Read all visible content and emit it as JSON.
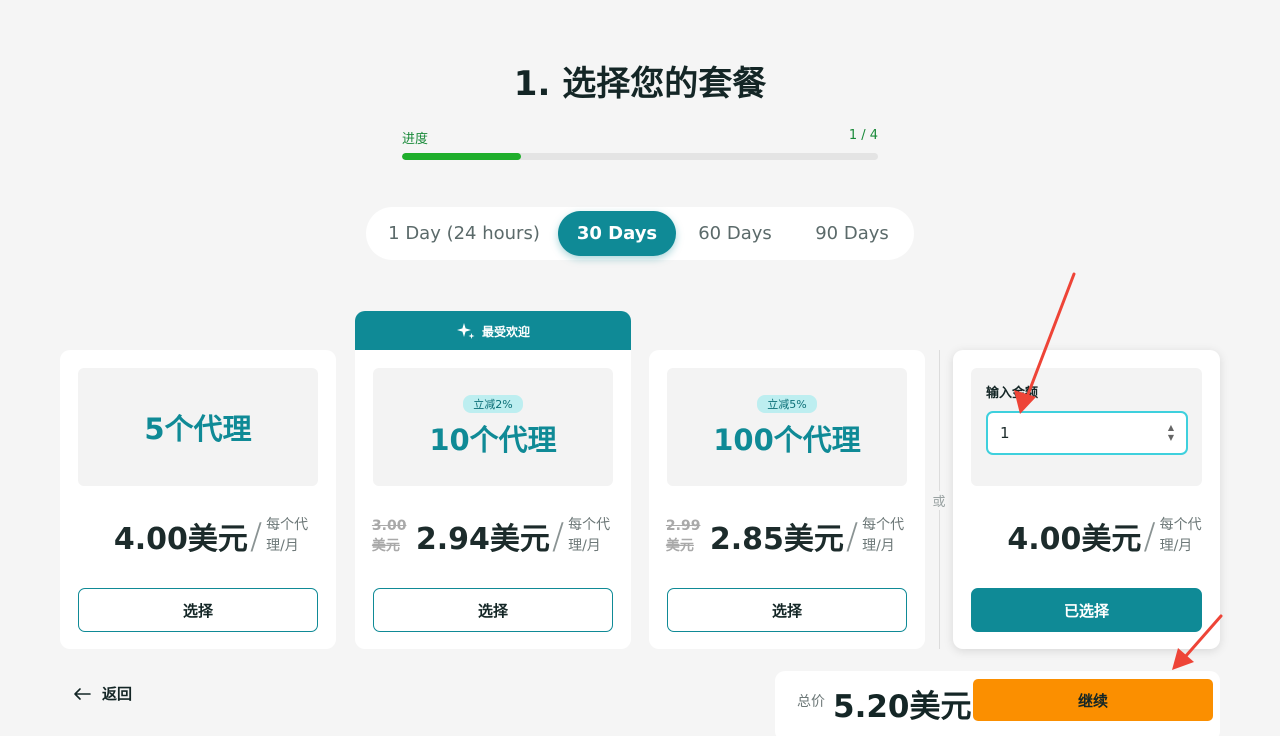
{
  "page_title": "1. 选择您的套餐",
  "progress": {
    "label": "进度",
    "step_text": "1 / 4",
    "fraction": 0.25
  },
  "duration_tabs": [
    {
      "label": "1 Day (24 hours)",
      "active": false
    },
    {
      "label": "30 Days",
      "active": true
    },
    {
      "label": "60 Days",
      "active": false
    },
    {
      "label": "90 Days",
      "active": false
    }
  ],
  "popular_banner": {
    "label": "最受欢迎",
    "icon": "sparkle-icon"
  },
  "plans": [
    {
      "name": "5个代理",
      "badge": "",
      "old_price": "",
      "price": "4.00美元",
      "slash": "/",
      "per": "每个代理/月",
      "button": "选择"
    },
    {
      "name": "10个代理",
      "badge": "立减2%",
      "old_price": "3.00美元",
      "price": "2.94美元",
      "slash": "/",
      "per": "每个代理/月",
      "button": "选择"
    },
    {
      "name": "100个代理",
      "badge": "立减5%",
      "old_price": "2.99美元",
      "price": "2.85美元",
      "slash": "/",
      "per": "每个代理/月",
      "button": "选择"
    }
  ],
  "or_label": "或",
  "custom": {
    "input_label": "输入金额",
    "input_value": "1",
    "price": "4.00美元",
    "slash": "/",
    "per": "每个代理/月",
    "button": "已选择"
  },
  "back_label": "返回",
  "total": {
    "label": "总价",
    "value": "5.20美元",
    "continue_label": "继续"
  },
  "colors": {
    "teal": "#0f8a96",
    "orange": "#fb8f00",
    "green": "#1fae2c",
    "annotation_red": "#ee4437"
  }
}
